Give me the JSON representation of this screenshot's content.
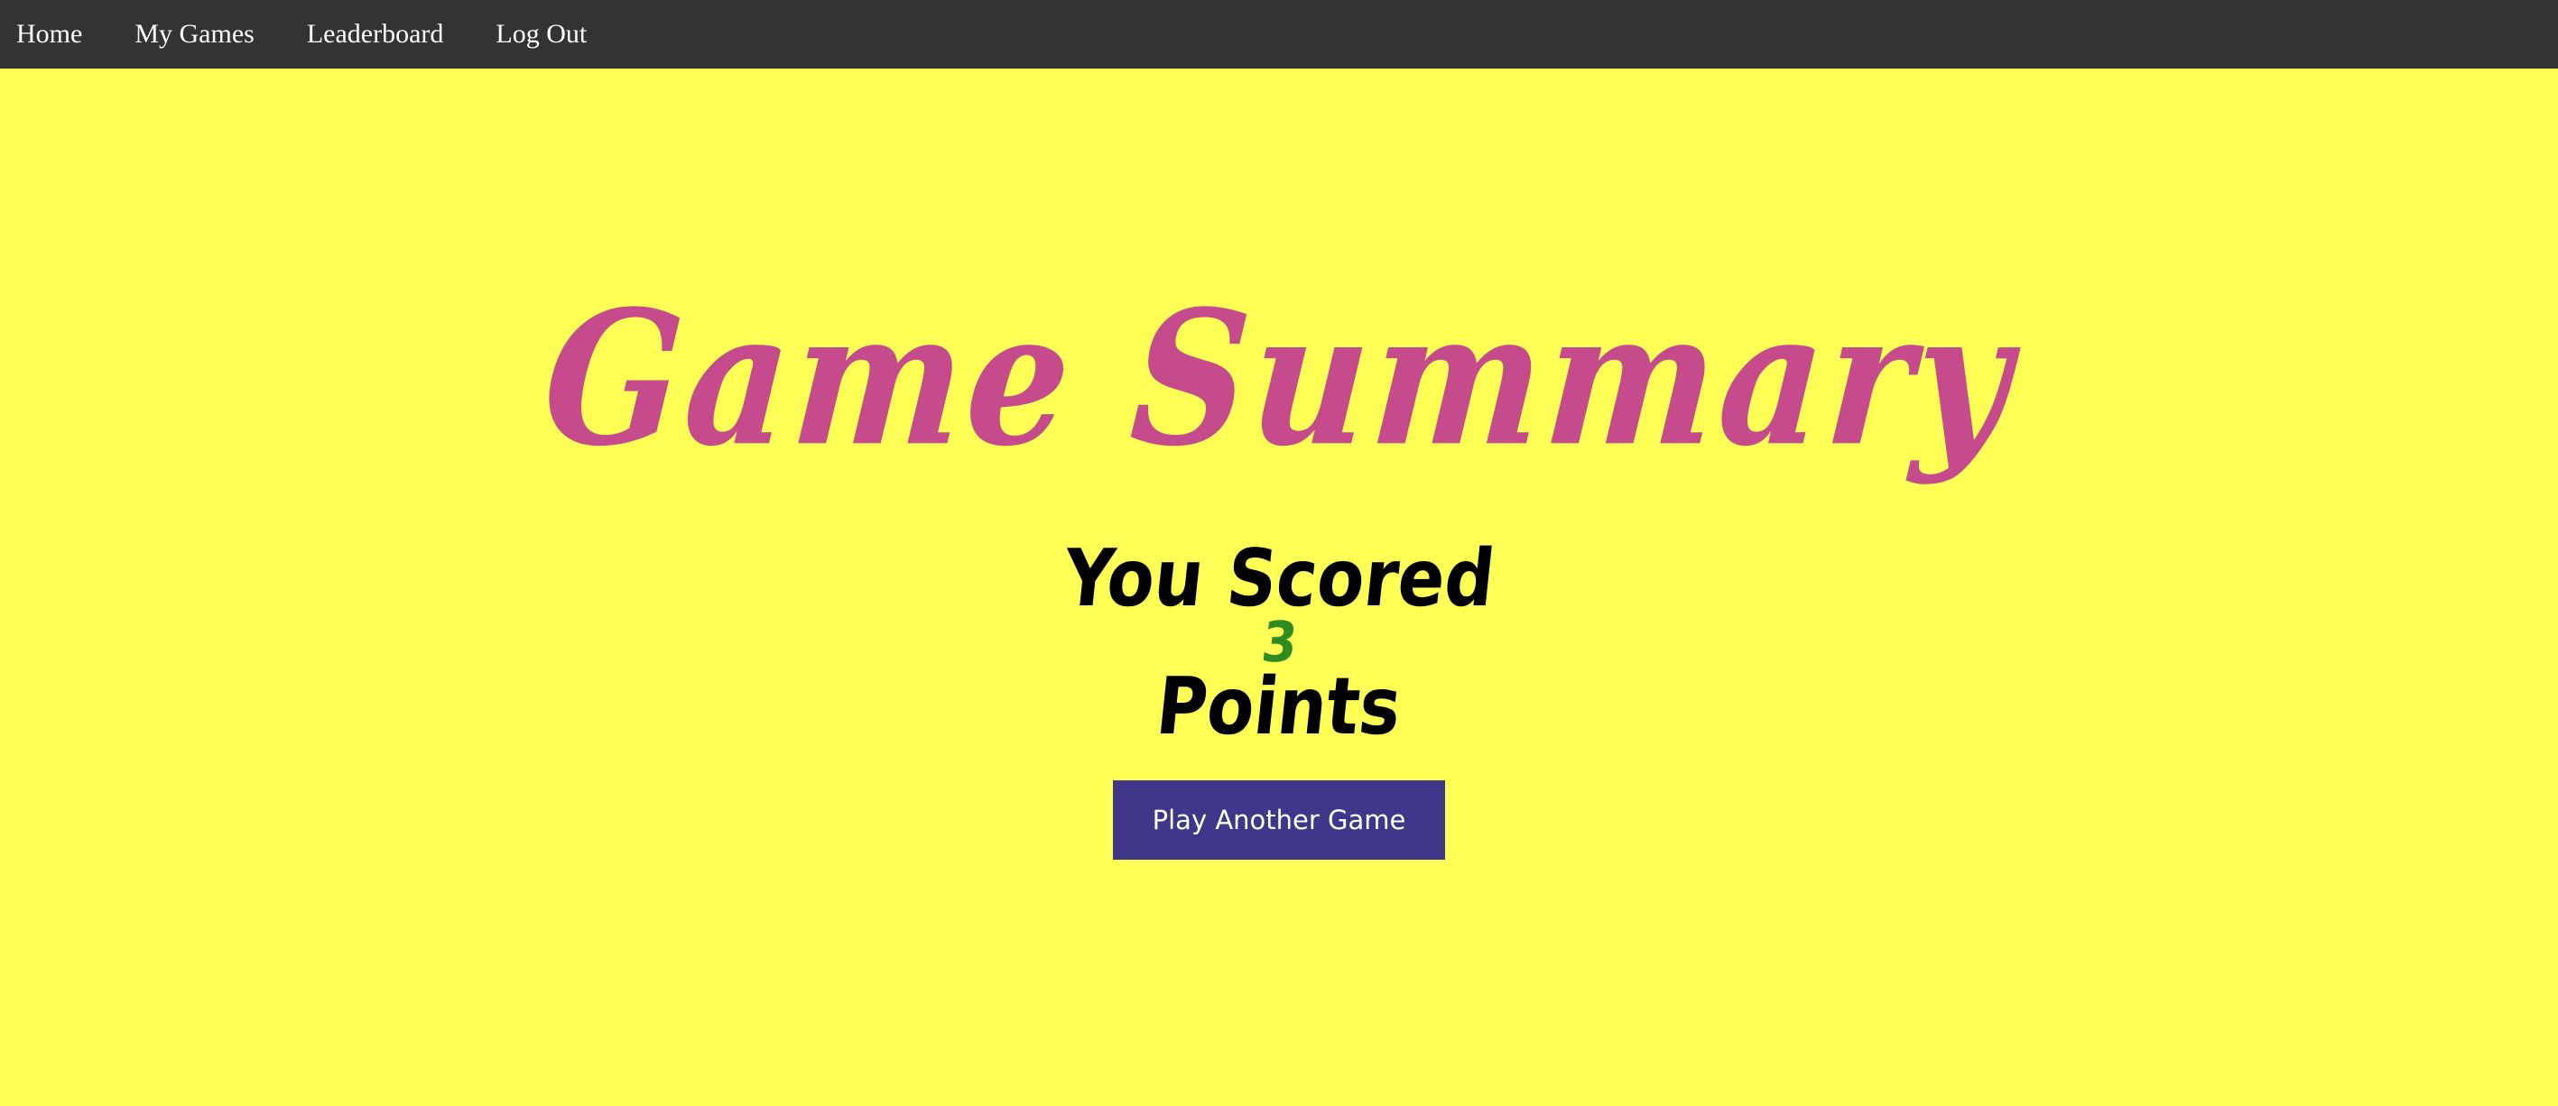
{
  "nav": {
    "items": [
      {
        "label": "Home"
      },
      {
        "label": "My Games"
      },
      {
        "label": "Leaderboard"
      },
      {
        "label": "Log Out"
      }
    ]
  },
  "main": {
    "title": "Game Summary",
    "score_prefix": "You Scored",
    "score_value": "3",
    "score_suffix": "Points",
    "play_button_label": "Play Another Game"
  },
  "colors": {
    "background": "#ffff55",
    "navbar": "#333333",
    "title": "#c54b8c",
    "score_value": "#2e8b1f",
    "button": "#40368a"
  }
}
